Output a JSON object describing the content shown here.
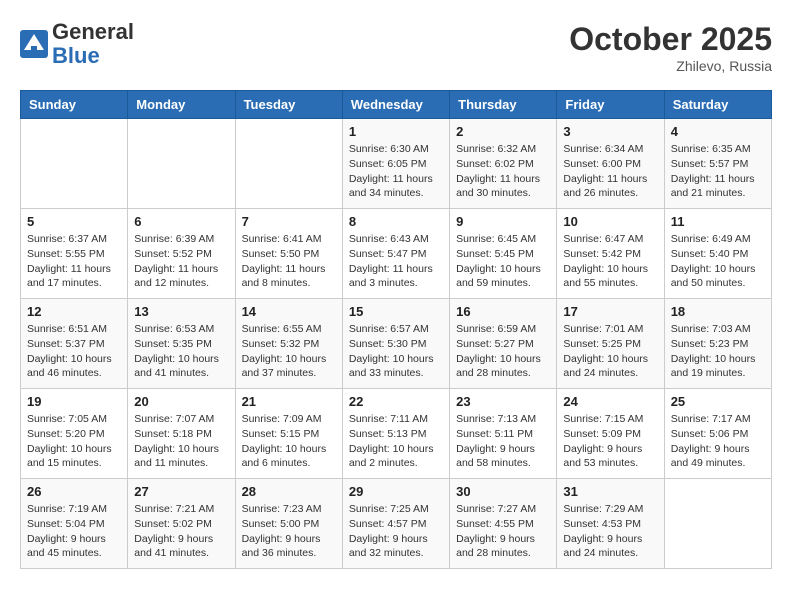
{
  "header": {
    "logo_general": "General",
    "logo_blue": "Blue",
    "month_title": "October 2025",
    "location": "Zhilevo, Russia"
  },
  "days_of_week": [
    "Sunday",
    "Monday",
    "Tuesday",
    "Wednesday",
    "Thursday",
    "Friday",
    "Saturday"
  ],
  "weeks": [
    [
      {
        "day": "",
        "sunrise": "",
        "sunset": "",
        "daylight": ""
      },
      {
        "day": "",
        "sunrise": "",
        "sunset": "",
        "daylight": ""
      },
      {
        "day": "",
        "sunrise": "",
        "sunset": "",
        "daylight": ""
      },
      {
        "day": "1",
        "sunrise": "Sunrise: 6:30 AM",
        "sunset": "Sunset: 6:05 PM",
        "daylight": "Daylight: 11 hours and 34 minutes."
      },
      {
        "day": "2",
        "sunrise": "Sunrise: 6:32 AM",
        "sunset": "Sunset: 6:02 PM",
        "daylight": "Daylight: 11 hours and 30 minutes."
      },
      {
        "day": "3",
        "sunrise": "Sunrise: 6:34 AM",
        "sunset": "Sunset: 6:00 PM",
        "daylight": "Daylight: 11 hours and 26 minutes."
      },
      {
        "day": "4",
        "sunrise": "Sunrise: 6:35 AM",
        "sunset": "Sunset: 5:57 PM",
        "daylight": "Daylight: 11 hours and 21 minutes."
      }
    ],
    [
      {
        "day": "5",
        "sunrise": "Sunrise: 6:37 AM",
        "sunset": "Sunset: 5:55 PM",
        "daylight": "Daylight: 11 hours and 17 minutes."
      },
      {
        "day": "6",
        "sunrise": "Sunrise: 6:39 AM",
        "sunset": "Sunset: 5:52 PM",
        "daylight": "Daylight: 11 hours and 12 minutes."
      },
      {
        "day": "7",
        "sunrise": "Sunrise: 6:41 AM",
        "sunset": "Sunset: 5:50 PM",
        "daylight": "Daylight: 11 hours and 8 minutes."
      },
      {
        "day": "8",
        "sunrise": "Sunrise: 6:43 AM",
        "sunset": "Sunset: 5:47 PM",
        "daylight": "Daylight: 11 hours and 3 minutes."
      },
      {
        "day": "9",
        "sunrise": "Sunrise: 6:45 AM",
        "sunset": "Sunset: 5:45 PM",
        "daylight": "Daylight: 10 hours and 59 minutes."
      },
      {
        "day": "10",
        "sunrise": "Sunrise: 6:47 AM",
        "sunset": "Sunset: 5:42 PM",
        "daylight": "Daylight: 10 hours and 55 minutes."
      },
      {
        "day": "11",
        "sunrise": "Sunrise: 6:49 AM",
        "sunset": "Sunset: 5:40 PM",
        "daylight": "Daylight: 10 hours and 50 minutes."
      }
    ],
    [
      {
        "day": "12",
        "sunrise": "Sunrise: 6:51 AM",
        "sunset": "Sunset: 5:37 PM",
        "daylight": "Daylight: 10 hours and 46 minutes."
      },
      {
        "day": "13",
        "sunrise": "Sunrise: 6:53 AM",
        "sunset": "Sunset: 5:35 PM",
        "daylight": "Daylight: 10 hours and 41 minutes."
      },
      {
        "day": "14",
        "sunrise": "Sunrise: 6:55 AM",
        "sunset": "Sunset: 5:32 PM",
        "daylight": "Daylight: 10 hours and 37 minutes."
      },
      {
        "day": "15",
        "sunrise": "Sunrise: 6:57 AM",
        "sunset": "Sunset: 5:30 PM",
        "daylight": "Daylight: 10 hours and 33 minutes."
      },
      {
        "day": "16",
        "sunrise": "Sunrise: 6:59 AM",
        "sunset": "Sunset: 5:27 PM",
        "daylight": "Daylight: 10 hours and 28 minutes."
      },
      {
        "day": "17",
        "sunrise": "Sunrise: 7:01 AM",
        "sunset": "Sunset: 5:25 PM",
        "daylight": "Daylight: 10 hours and 24 minutes."
      },
      {
        "day": "18",
        "sunrise": "Sunrise: 7:03 AM",
        "sunset": "Sunset: 5:23 PM",
        "daylight": "Daylight: 10 hours and 19 minutes."
      }
    ],
    [
      {
        "day": "19",
        "sunrise": "Sunrise: 7:05 AM",
        "sunset": "Sunset: 5:20 PM",
        "daylight": "Daylight: 10 hours and 15 minutes."
      },
      {
        "day": "20",
        "sunrise": "Sunrise: 7:07 AM",
        "sunset": "Sunset: 5:18 PM",
        "daylight": "Daylight: 10 hours and 11 minutes."
      },
      {
        "day": "21",
        "sunrise": "Sunrise: 7:09 AM",
        "sunset": "Sunset: 5:15 PM",
        "daylight": "Daylight: 10 hours and 6 minutes."
      },
      {
        "day": "22",
        "sunrise": "Sunrise: 7:11 AM",
        "sunset": "Sunset: 5:13 PM",
        "daylight": "Daylight: 10 hours and 2 minutes."
      },
      {
        "day": "23",
        "sunrise": "Sunrise: 7:13 AM",
        "sunset": "Sunset: 5:11 PM",
        "daylight": "Daylight: 9 hours and 58 minutes."
      },
      {
        "day": "24",
        "sunrise": "Sunrise: 7:15 AM",
        "sunset": "Sunset: 5:09 PM",
        "daylight": "Daylight: 9 hours and 53 minutes."
      },
      {
        "day": "25",
        "sunrise": "Sunrise: 7:17 AM",
        "sunset": "Sunset: 5:06 PM",
        "daylight": "Daylight: 9 hours and 49 minutes."
      }
    ],
    [
      {
        "day": "26",
        "sunrise": "Sunrise: 7:19 AM",
        "sunset": "Sunset: 5:04 PM",
        "daylight": "Daylight: 9 hours and 45 minutes."
      },
      {
        "day": "27",
        "sunrise": "Sunrise: 7:21 AM",
        "sunset": "Sunset: 5:02 PM",
        "daylight": "Daylight: 9 hours and 41 minutes."
      },
      {
        "day": "28",
        "sunrise": "Sunrise: 7:23 AM",
        "sunset": "Sunset: 5:00 PM",
        "daylight": "Daylight: 9 hours and 36 minutes."
      },
      {
        "day": "29",
        "sunrise": "Sunrise: 7:25 AM",
        "sunset": "Sunset: 4:57 PM",
        "daylight": "Daylight: 9 hours and 32 minutes."
      },
      {
        "day": "30",
        "sunrise": "Sunrise: 7:27 AM",
        "sunset": "Sunset: 4:55 PM",
        "daylight": "Daylight: 9 hours and 28 minutes."
      },
      {
        "day": "31",
        "sunrise": "Sunrise: 7:29 AM",
        "sunset": "Sunset: 4:53 PM",
        "daylight": "Daylight: 9 hours and 24 minutes."
      },
      {
        "day": "",
        "sunrise": "",
        "sunset": "",
        "daylight": ""
      }
    ]
  ]
}
